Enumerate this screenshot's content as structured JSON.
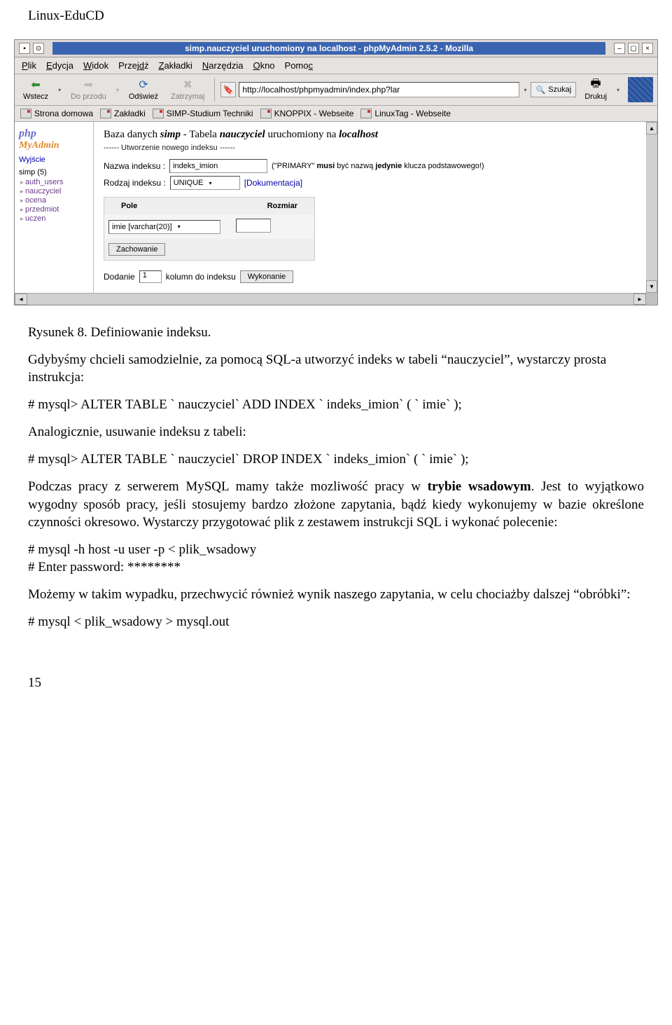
{
  "header": {
    "title": "Linux-EduCD"
  },
  "browser": {
    "window_title": "simp.nauczyciel uruchomiony na localhost - phpMyAdmin 2.5.2 - Mozilla",
    "menu": [
      "Plik",
      "Edycja",
      "Widok",
      "Przejdź",
      "Zakładki",
      "Narzędzia",
      "Okno",
      "Pomoc"
    ],
    "toolbar": {
      "back": "Wstecz",
      "forward": "Do przodu",
      "reload": "Odśwież",
      "stop": "Zatrzymaj",
      "url": "http://localhost/phpmyadmin/index.php?lar",
      "search_label": "Szukaj",
      "print": "Drukuj"
    },
    "bookmarks": [
      "Strona domowa",
      "Zakładki",
      "SIMP-Studium Techniki",
      "KNOPPIX - Webseite",
      "LinuxTag - Webseite"
    ],
    "sidebar": {
      "exit": "Wyjście",
      "db": "simp  (5)",
      "tables": [
        "auth_users",
        "nauczyciel",
        "ocena",
        "przedmiot",
        "uczen"
      ]
    },
    "main": {
      "heading_prefix": "Baza danych ",
      "heading_db": "simp",
      "heading_mid": " - Tabela ",
      "heading_tbl": "nauczyciel",
      "heading_suffix_a": " uruchomiony na ",
      "heading_host": "localhost",
      "subhead": "------ Utworzenie nowego indeksu ------",
      "label_name": "Nazwa indeksu :",
      "val_name": "indeks_imion",
      "note_primary": "(\"PRIMARY\" musi być nazwą jedynie klucza podstawowego!)",
      "label_type": "Rodzaj indeksu :",
      "val_type": "UNIQUE",
      "doclink": "[Dokumentacja]",
      "col_field": "Pole",
      "col_size": "Rozmiar",
      "field_val": "imie [varchar(20)]",
      "save": "Zachowanie",
      "add_prefix": "Dodanie",
      "add_count": "1",
      "add_suffix": "kolumn do indeksu",
      "add_btn": "Wykonanie"
    }
  },
  "doc": {
    "caption": "Rysunek 8. Definiowanie indeksu.",
    "p1": "Gdybyśmy chcieli samodzielnie, za pomocą SQL-a utworzyć indeks w tabeli “nauczyciel”, wystarczy prosta instrukcja:",
    "code1": "# mysql> ALTER TABLE ` nauczyciel`  ADD INDEX ` indeks_imion`  ( ` imie`  );",
    "p2": "Analogicznie, usuwanie indeksu z tabeli:",
    "code2": "# mysql> ALTER TABLE ` nauczyciel`  DROP INDEX ` indeks_imion`  ( ` imie`  );",
    "p3a": "Podczas pracy z serwerem MySQL mamy także mozliwość pracy w ",
    "p3b": "trybie wsadowym",
    "p3c": ". Jest to wyjątkowo wygodny sposób pracy, jeśli stosujemy bardzo złożone zapytania, bądź kiedy wykonujemy w bazie określone czynności okresowo. Wystarczy przygotować plik z zestawem instrukcji SQL i wykonać polecenie:",
    "code3a": "# mysql -h host -u user -p < plik_wsadowy",
    "code3b": "# Enter password: ********",
    "p4": "Możemy w takim wypadku, przechwycić również wynik naszego zapytania, w celu chociażby dalszej “obróbki”:",
    "code4": "# mysql < plik_wsadowy > mysql.out",
    "page_number": "15"
  }
}
